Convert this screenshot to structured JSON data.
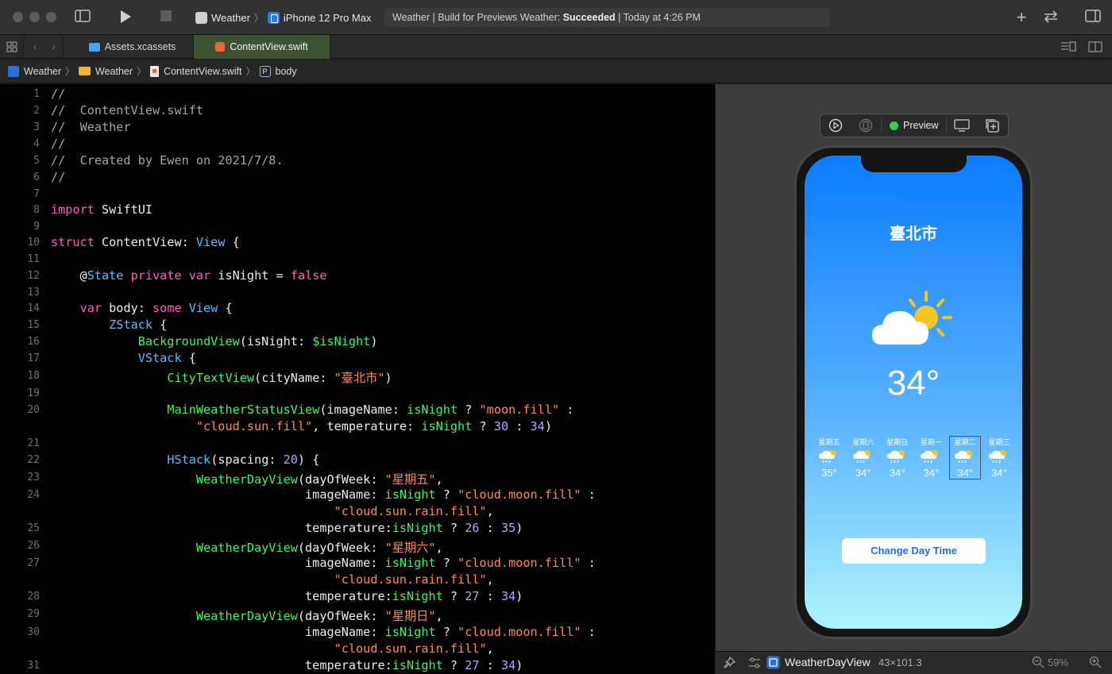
{
  "toolbar": {
    "scheme_app": "Weather",
    "scheme_device": "iPhone 12 Pro Max",
    "activity_prefix": "Weather | Build for Previews Weather: ",
    "activity_status": "Succeeded",
    "activity_time": "| Today at 4:26 PM"
  },
  "tabs": [
    {
      "label": "Assets.xcassets",
      "active": false
    },
    {
      "label": "ContentView.swift",
      "active": true
    }
  ],
  "breadcrumb": [
    "Weather",
    "Weather",
    "ContentView.swift",
    "body"
  ],
  "editor": {
    "line_numbers": [
      "1",
      "2",
      "3",
      "4",
      "5",
      "6",
      "7",
      "8",
      "9",
      "10",
      "11",
      "12",
      "13",
      "14",
      "15",
      "16",
      "17",
      "18",
      "19",
      "20",
      "21",
      "22",
      "23",
      "24",
      "25",
      "26",
      "27",
      "28",
      "29",
      "30",
      "31"
    ]
  },
  "preview": {
    "label": "Preview",
    "city": "臺北市",
    "temperature": "34°",
    "days": [
      {
        "dow": "星期五",
        "temp": "35°"
      },
      {
        "dow": "星期六",
        "temp": "34°"
      },
      {
        "dow": "星期日",
        "temp": "34°"
      },
      {
        "dow": "星期一",
        "temp": "34°"
      },
      {
        "dow": "星期二",
        "temp": "34°"
      },
      {
        "dow": "星期三",
        "temp": "34°"
      }
    ],
    "button_label": "Change Day Time"
  },
  "status": {
    "selection_name": "WeatherDayView",
    "selection_size": "43×101.3",
    "zoom": "59%"
  }
}
